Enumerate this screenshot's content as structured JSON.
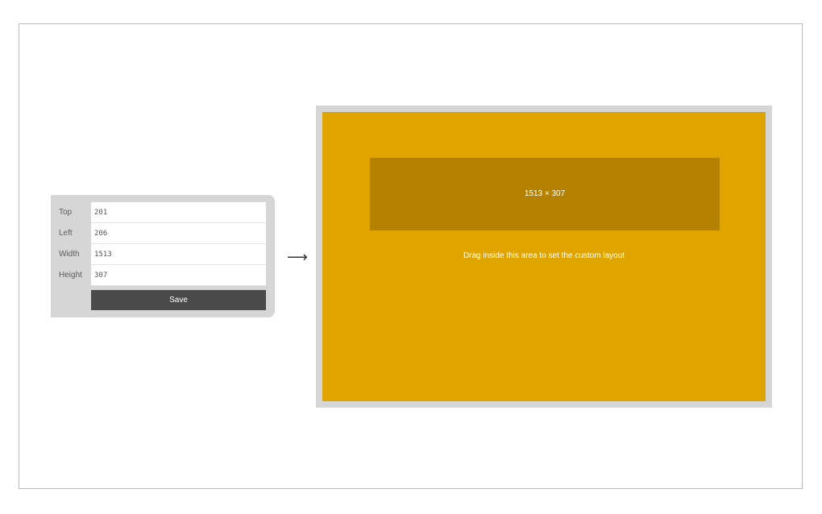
{
  "form": {
    "fields": [
      {
        "label": "Top",
        "value": "201"
      },
      {
        "label": "Left",
        "value": "206"
      },
      {
        "label": "Width",
        "value": "1513"
      },
      {
        "label": "Height",
        "value": "307"
      }
    ],
    "save_label": "Save"
  },
  "arrow_glyph": "⟶",
  "canvas": {
    "selection_label": "1513 × 307",
    "hint": "Drag inside this area to set the custom layout",
    "colors": {
      "canvas": "#e0a400",
      "selection": "#b58100",
      "canvas_border": "#d6d6d6"
    }
  }
}
